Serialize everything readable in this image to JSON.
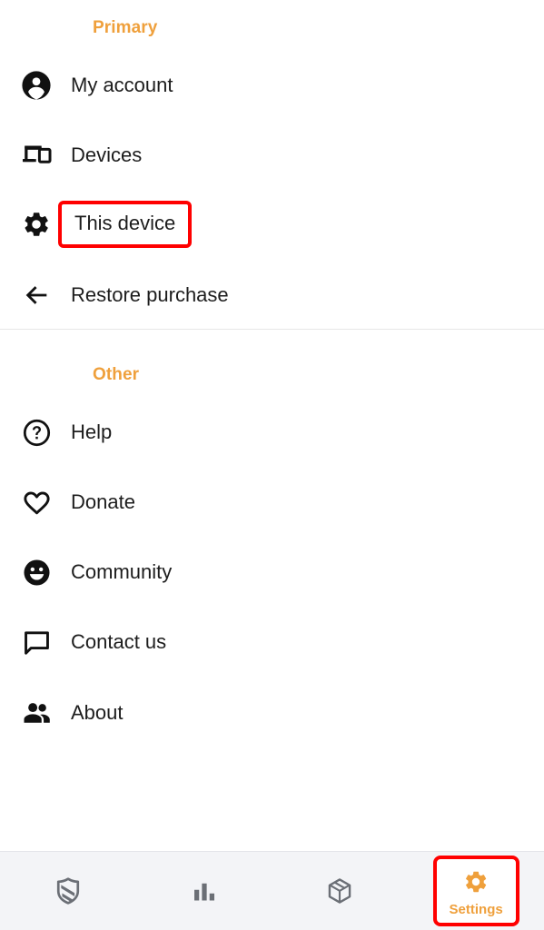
{
  "accent_color": "#EFA03C",
  "highlight_color": "#FF0000",
  "icon_color": "#111111",
  "nav_background": "#F3F4F7",
  "sections": [
    {
      "title": "Primary",
      "items": [
        {
          "label": "My account",
          "icon": "account-circle-icon",
          "highlighted": false
        },
        {
          "label": "Devices",
          "icon": "devices-icon",
          "highlighted": false
        },
        {
          "label": "This device",
          "icon": "gear-icon",
          "highlighted": true
        },
        {
          "label": "Restore purchase",
          "icon": "arrow-left-icon",
          "highlighted": false
        }
      ]
    },
    {
      "title": "Other",
      "items": [
        {
          "label": "Help",
          "icon": "help-circle-icon",
          "highlighted": false
        },
        {
          "label": "Donate",
          "icon": "heart-icon",
          "highlighted": false
        },
        {
          "label": "Community",
          "icon": "smiley-face-icon",
          "highlighted": false
        },
        {
          "label": "Contact us",
          "icon": "speech-bubble-icon",
          "highlighted": false
        },
        {
          "label": "About",
          "icon": "people-group-icon",
          "highlighted": false
        }
      ]
    }
  ],
  "bottom_nav": {
    "tabs": [
      {
        "label": "",
        "icon": "shield-icon",
        "selected": false
      },
      {
        "label": "",
        "icon": "bar-chart-icon",
        "selected": false
      },
      {
        "label": "",
        "icon": "package-box-icon",
        "selected": false
      },
      {
        "label": "Settings",
        "icon": "gear-icon",
        "selected": true
      }
    ]
  }
}
